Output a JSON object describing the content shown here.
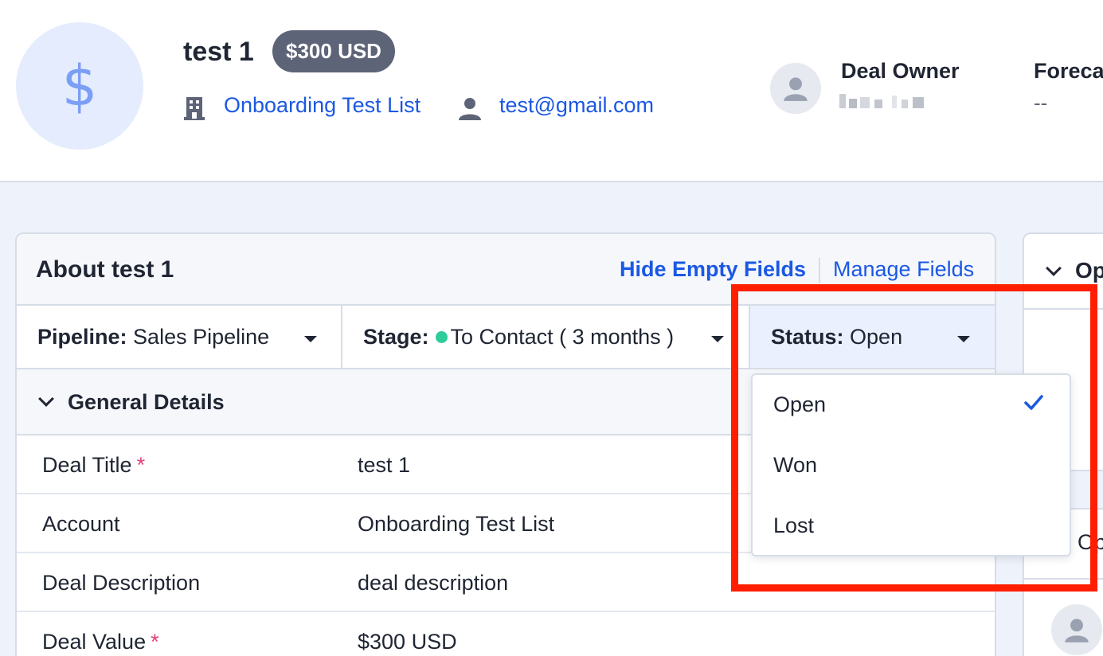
{
  "header": {
    "avatar_symbol": "$",
    "deal_title": "test 1",
    "value_badge": "$300 USD",
    "account_link": "Onboarding Test List",
    "email_link": "test@gmail.com",
    "owner_label": "Deal Owner",
    "forecast_label": "Foreca",
    "forecast_value": "--"
  },
  "card": {
    "title": "About test 1",
    "hide_empty": "Hide Empty Fields",
    "manage_fields": "Manage Fields",
    "pipeline": {
      "label": "Pipeline:",
      "value": "Sales Pipeline"
    },
    "stage": {
      "label": "Stage:",
      "value": "To Contact ( 3 months )",
      "dot_color": "#2ecc9b"
    },
    "status": {
      "label": "Status:",
      "value": "Open"
    },
    "section_title": "General Details",
    "fields": [
      {
        "label": "Deal Title",
        "required": "*",
        "value": "test 1"
      },
      {
        "label": "Account",
        "required": "",
        "value": "Onboarding Test List"
      },
      {
        "label": "Deal Description",
        "required": "",
        "value": "deal description"
      },
      {
        "label": "Deal Value",
        "required": "*",
        "value": "$300 USD"
      }
    ]
  },
  "right_panel": {
    "title": "Op",
    "item": "Op"
  },
  "dropdown": {
    "options": [
      "Open",
      "Won",
      "Lost"
    ],
    "selected": "Open"
  },
  "colors": {
    "accent": "#1b58e3",
    "badge": "#5d6477",
    "highlight": "#ff1e00",
    "required": "#e0407a"
  }
}
